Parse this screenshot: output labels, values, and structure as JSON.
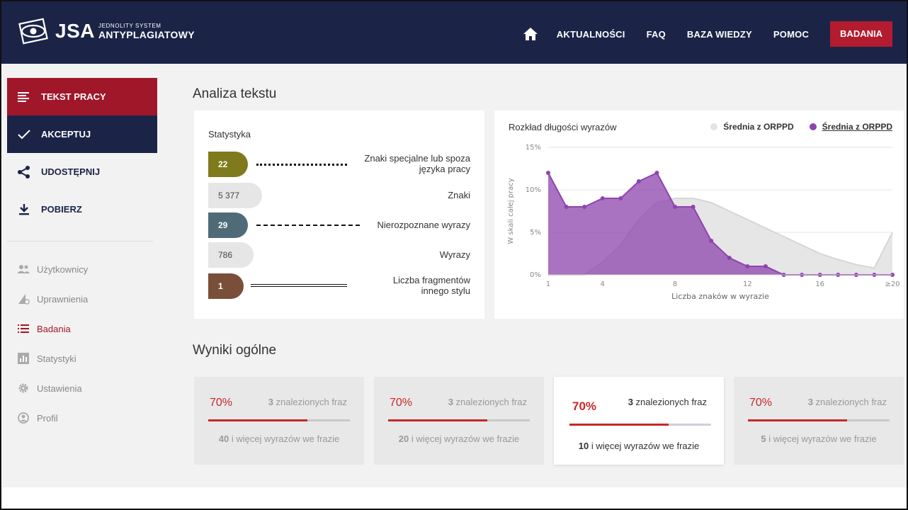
{
  "brand": {
    "name": "JSA",
    "sub_top": "JEDNOLITY SYSTEM",
    "sub_bottom": "ANTYPLAGIATOWY"
  },
  "nav": {
    "items": [
      "AKTUALNOŚCI",
      "FAQ",
      "BAZA WIEDZY",
      "POMOC"
    ],
    "cta": "BADANIA",
    "home_icon": "home-icon"
  },
  "sidebar": {
    "actions": [
      {
        "label": "TEKST PRACY",
        "icon": "text-lines-icon",
        "style": "red"
      },
      {
        "label": "AKCEPTUJ",
        "icon": "check-icon",
        "style": "navy"
      },
      {
        "label": "UDOSTĘPNIJ",
        "icon": "share-icon",
        "style": "plain"
      },
      {
        "label": "POBIERZ",
        "icon": "download-icon",
        "style": "plain"
      }
    ],
    "nav": [
      {
        "label": "Użytkownicy",
        "icon": "users-icon",
        "active": false
      },
      {
        "label": "Uprawnienia",
        "icon": "permissions-icon",
        "active": false
      },
      {
        "label": "Badania",
        "icon": "list-icon",
        "active": true
      },
      {
        "label": "Statystyki",
        "icon": "bar-chart-icon",
        "active": false
      },
      {
        "label": "Ustawienia",
        "icon": "gear-icon",
        "active": false
      },
      {
        "label": "Profil",
        "icon": "user-circle-icon",
        "active": false
      }
    ]
  },
  "analysis": {
    "title": "Analiza tekstu",
    "stats_heading": "Statystyka",
    "stats": [
      {
        "value": "22",
        "label": "Znaki specjalne lub spoza języka pracy",
        "color": "#7f7a1c"
      },
      {
        "value": "5 377",
        "label": "Znaki",
        "color": "light"
      },
      {
        "value": "29",
        "label": "Nierozpoznane wyrazy",
        "color": "#4f6b78"
      },
      {
        "value": "786",
        "label": "Wyrazy",
        "color": "light"
      },
      {
        "value": "1",
        "label": "Liczba fragmentów innego stylu",
        "color": "#7a4f3a"
      }
    ]
  },
  "chart": {
    "title": "Rozkład długości wyrazów",
    "legend": [
      {
        "label": "Średnia z ORPPD",
        "color": "#e3e3e3"
      },
      {
        "label": "Średnia z ORPPD",
        "color": "#8e44ad"
      }
    ]
  },
  "chart_data": {
    "type": "area",
    "title": "Rozkład długości wyrazów",
    "xlabel": "Liczba znaków w wyrazie",
    "ylabel": "W skali całej pracy",
    "x": [
      1,
      2,
      3,
      4,
      5,
      6,
      7,
      8,
      9,
      10,
      11,
      12,
      13,
      14,
      15,
      16,
      17,
      18,
      19,
      20
    ],
    "x_tick_labels": [
      "1",
      "4",
      "8",
      "12",
      "16",
      "≥20"
    ],
    "x_tick_positions": [
      1,
      4,
      8,
      12,
      16,
      20
    ],
    "y_tick_labels": [
      "0%",
      "5%",
      "10%",
      "15%"
    ],
    "ylim": [
      0,
      15
    ],
    "series": [
      {
        "name": "Średnia z ORPPD",
        "color": "#e3e3e3",
        "values": [
          0,
          0,
          0,
          1.5,
          3.5,
          6.5,
          8.5,
          9,
          9,
          8.5,
          7.5,
          6.5,
          5.5,
          4.5,
          3.5,
          2.5,
          1.8,
          1.2,
          0.8,
          5
        ]
      },
      {
        "name": "Średnia z ORPPD",
        "color": "#8e44ad",
        "values": [
          12,
          8,
          8,
          9,
          9,
          11,
          12,
          8,
          8,
          4,
          2,
          1,
          1,
          0,
          0,
          0,
          0,
          0,
          0,
          0
        ]
      }
    ]
  },
  "results": {
    "title": "Wyniki ogólne",
    "cards": [
      {
        "percent": "70%",
        "fill": 0.7,
        "count": "3",
        "count_suffix": " znalezionych fraz",
        "words": "40",
        "words_suffix": " i więcej wyrazów we frazie",
        "highlight": false
      },
      {
        "percent": "70%",
        "fill": 0.7,
        "count": "3",
        "count_suffix": " znalezionych fraz",
        "words": "20",
        "words_suffix": " i więcej wyrazów we frazie",
        "highlight": false
      },
      {
        "percent": "70%",
        "fill": 0.7,
        "count": "3",
        "count_suffix": " znalezionych fraz",
        "words": "10",
        "words_suffix": " i więcej wyrazów we frazie",
        "highlight": true
      },
      {
        "percent": "70%",
        "fill": 0.7,
        "count": "3",
        "count_suffix": " znalezionych fraz",
        "words": "5",
        "words_suffix": " i więcej wyrazów we frazie",
        "highlight": false
      }
    ]
  }
}
